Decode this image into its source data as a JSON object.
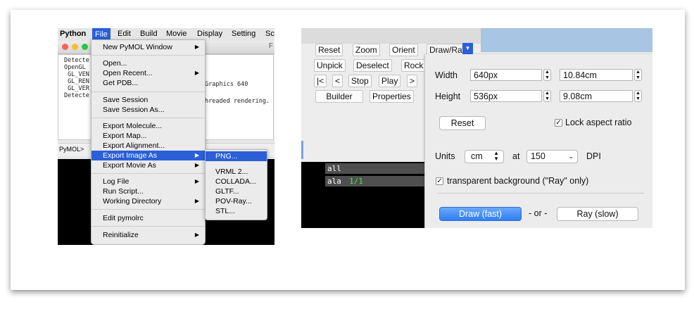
{
  "pymol_menu_window": {
    "menubar": [
      "Python",
      "File",
      "Edit",
      "Build",
      "Movie",
      "Display",
      "Setting",
      "Sc"
    ],
    "title_fragment": "F",
    "console_lines": [
      "Detecte",
      "OpenGL",
      " GL_VEN",
      " GL_REN",
      " GL_VER",
      "Detecte"
    ],
    "console_right_fragments": [
      "Graphics 640",
      "hreaded rendering."
    ],
    "prompt": "PyMOL>",
    "file_menu": {
      "items": [
        {
          "label": "New PyMOL Window",
          "arrow": "▶"
        },
        {
          "label": "Open...",
          "arrow": ""
        },
        {
          "label": "Open Recent...",
          "arrow": "▶"
        },
        {
          "label": "Get PDB...",
          "arrow": ""
        },
        {
          "label": "Save Session",
          "arrow": ""
        },
        {
          "label": "Save Session As...",
          "arrow": ""
        },
        {
          "label": "Export Molecule...",
          "arrow": ""
        },
        {
          "label": "Export Map...",
          "arrow": ""
        },
        {
          "label": "Export Alignment...",
          "arrow": ""
        },
        {
          "label": "Export Image As",
          "arrow": "▶"
        },
        {
          "label": "Export Movie As",
          "arrow": "▶"
        },
        {
          "label": "Log File",
          "arrow": "▶"
        },
        {
          "label": "Run Script...",
          "arrow": ""
        },
        {
          "label": "Working Directory",
          "arrow": "▶"
        },
        {
          "label": "Edit pymolrc",
          "arrow": ""
        },
        {
          "label": "Reinitialize",
          "arrow": "▶"
        }
      ]
    },
    "export_submenu": [
      "PNG...",
      "VRML 2...",
      "COLLADA...",
      "GLTF...",
      "POV-Ray...",
      "STL..."
    ]
  },
  "draw_ray_window": {
    "buttons_row1": [
      "Reset",
      "Zoom",
      "Orient",
      "Draw/Ray"
    ],
    "buttons_row2": [
      "Unpick",
      "Deselect",
      "Rock"
    ],
    "buttons_row3": [
      "|<",
      "<",
      "Stop",
      "Play",
      ">"
    ],
    "tabs": [
      "Builder",
      "Properties"
    ],
    "objects": [
      {
        "name": "all",
        "state": ""
      },
      {
        "name": "ala",
        "state": "1/1"
      }
    ],
    "sheet": {
      "width_label": "Width",
      "width_px": "640px",
      "width_cm": "10.84cm",
      "height_label": "Height",
      "height_px": "536px",
      "height_cm": "9.08cm",
      "reset_label": "Reset",
      "lock_label": "Lock aspect ratio",
      "lock_checked": true,
      "units_label": "Units",
      "units_value": "cm",
      "at_label": "at",
      "dpi_value": "150",
      "dpi_label": "DPI",
      "transparent_label": "transparent background (\"Ray\" only)",
      "transparent_checked": true,
      "draw_label": "Draw (fast)",
      "or_label": "- or -",
      "ray_label": "Ray (slow)"
    }
  },
  "colors": {
    "accent_blue": "#2a5fd8",
    "primary_button": "#2f7ef3",
    "sky_blue": "#a9c5e4",
    "green_state": "#4ee04e"
  }
}
